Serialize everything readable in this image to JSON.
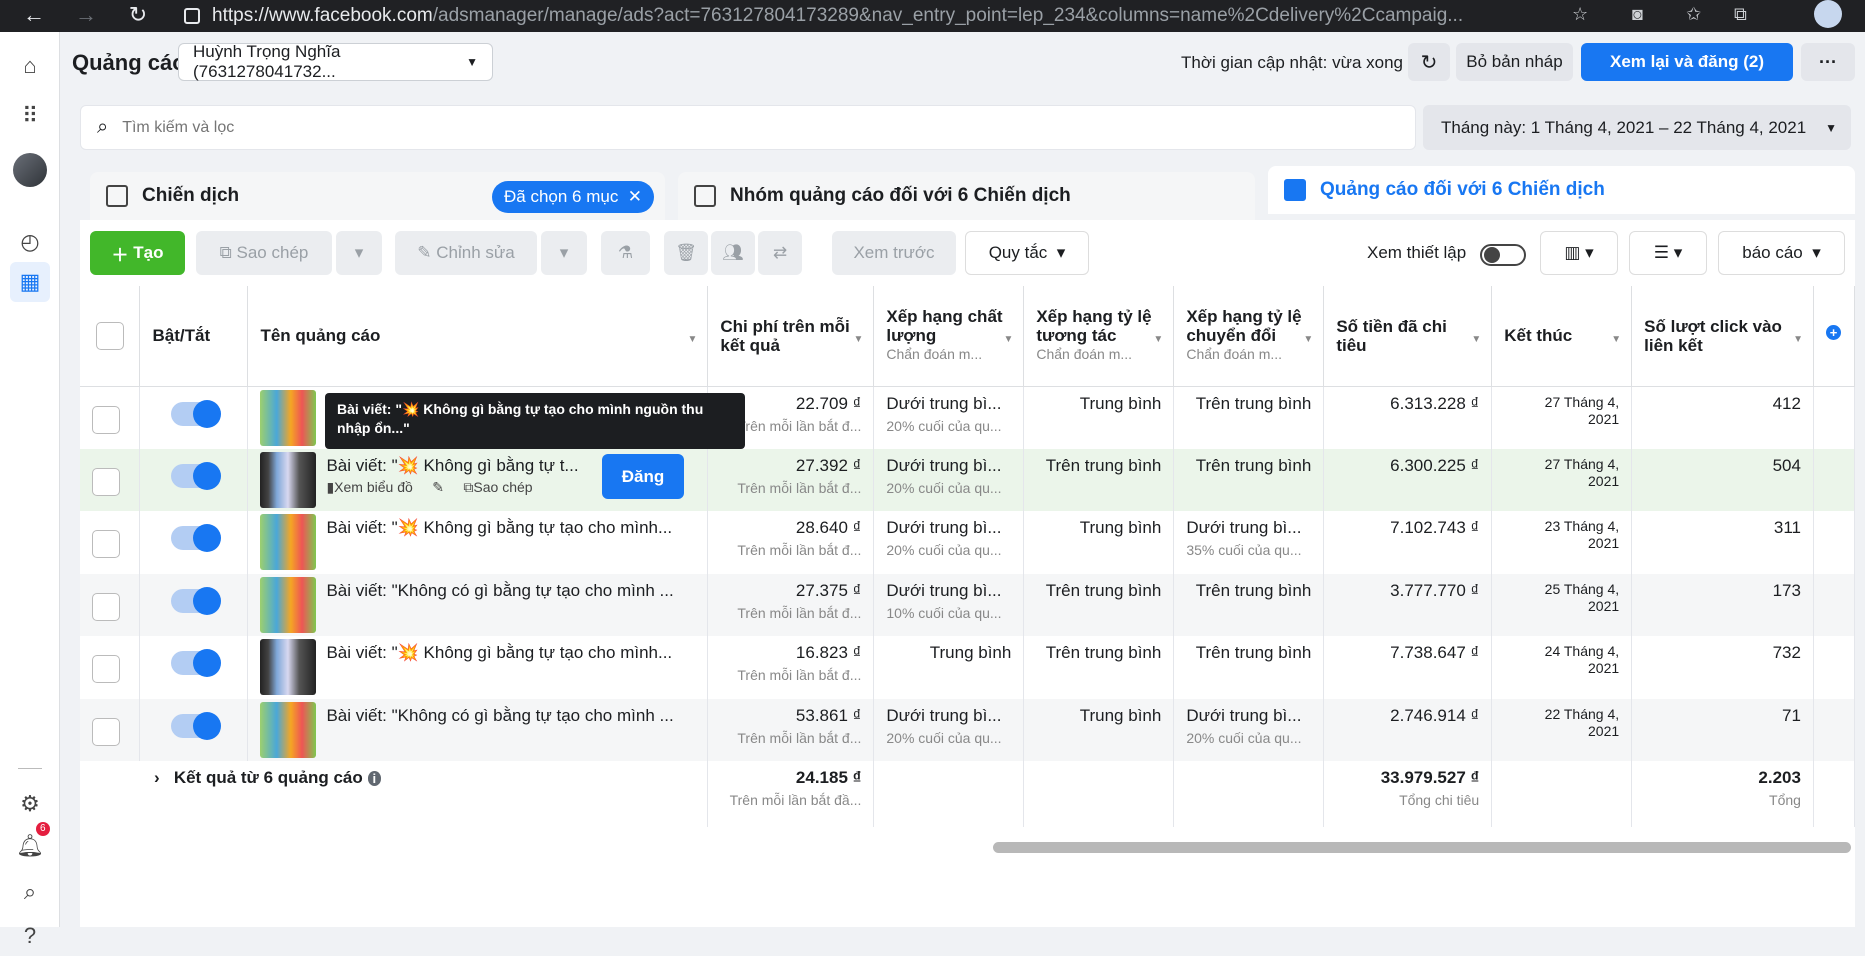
{
  "browser": {
    "url_main": "https://www.facebook.com",
    "url_rest": "/adsmanager/manage/ads?act=763127804173289&nav_entry_point=lep_234&columns=name%2Cdelivery%2Ccampaig..."
  },
  "header": {
    "title": "Quảng cáo",
    "account": "Huỳnh Trọng Nghĩa (7631278041732...",
    "update_status": "Thời gian cập nhật: vừa xong",
    "discard_drafts": "Bỏ bản nháp",
    "review_publish": "Xem lại và đăng (2)",
    "more": "···"
  },
  "search": {
    "placeholder": "Tìm kiếm và lọc"
  },
  "date_range": "Tháng này: 1 Tháng 4, 2021 – 22 Tháng 4, 2021",
  "tabs": {
    "campaigns": "Chiến dịch",
    "selected_chip": "Đã chọn 6 mục",
    "adsets": "Nhóm quảng cáo đối với 6 Chiến dịch",
    "ads": "Quảng cáo đối với 6 Chiến dịch"
  },
  "toolbar": {
    "create": "Tạo",
    "duplicate": "Sao chép",
    "edit": "Chỉnh sửa",
    "preview": "Xem trước",
    "rules": "Quy tắc",
    "view_setup": "Xem thiết lập",
    "reports": "báo cáo"
  },
  "columns": {
    "toggle": "Bật/Tắt",
    "name": "Tên quảng cáo",
    "cost_per_result": "Chi phí trên mỗi kết quả",
    "quality": "Xếp hạng chất lượng",
    "quality_sub": "Chẩn đoán m...",
    "engagement": "Xếp hạng tỷ lệ tương tác",
    "engagement_sub": "Chẩn đoán m...",
    "conversion": "Xếp hạng tỷ lệ chuyển đổi",
    "conversion_sub": "Chẩn đoán m...",
    "spent": "Số tiền đã chi tiêu",
    "ends": "Kết thúc",
    "link_clicks": "Số lượt click vào liên kết"
  },
  "rows": [
    {
      "name": "Bài viết: \"💥 Không gì bằng tự tạo cho mình...",
      "cost": "22.709 ₫",
      "cost_sub": "Trên mỗi lần bắt đ...",
      "quality": "Dưới trung bì...",
      "quality_sub": "20% cuối của qu...",
      "engagement": "Trung bình",
      "conversion": "Trên trung bình",
      "conversion_sub": "",
      "spent": "6.313.228 ₫",
      "end_1": "27 Tháng 4,",
      "end_2": "2021",
      "clicks": "412"
    },
    {
      "name": "Bài viết: \"💥 Không gì bằng tự t...",
      "cost": "27.392 ₫",
      "cost_sub": "Trên mỗi lần bắt đ...",
      "quality": "Dưới trung bì...",
      "quality_sub": "20% cuối của qu...",
      "engagement": "Trên trung bình",
      "conversion": "Trên trung bình",
      "conversion_sub": "",
      "spent": "6.300.225 ₫",
      "end_1": "27 Tháng 4,",
      "end_2": "2021",
      "clicks": "504"
    },
    {
      "name": "Bài viết: \"💥 Không gì bằng tự tạo cho mình...",
      "cost": "28.640 ₫",
      "cost_sub": "Trên mỗi lần bắt đ...",
      "quality": "Dưới trung bì...",
      "quality_sub": "20% cuối của qu...",
      "engagement": "Trung bình",
      "conversion": "Dưới trung bì...",
      "conversion_sub": "35% cuối của qu...",
      "spent": "7.102.743 ₫",
      "end_1": "23 Tháng 4,",
      "end_2": "2021",
      "clicks": "311"
    },
    {
      "name": "Bài viết: \"Không có gì bằng tự tạo cho mình ...",
      "cost": "27.375 ₫",
      "cost_sub": "Trên mỗi lần bắt đ...",
      "quality": "Dưới trung bì...",
      "quality_sub": "10% cuối của qu...",
      "engagement": "Trên trung bình",
      "conversion": "Trên trung bình",
      "conversion_sub": "",
      "spent": "3.777.770 ₫",
      "end_1": "25 Tháng 4,",
      "end_2": "2021",
      "clicks": "173"
    },
    {
      "name": "Bài viết: \"💥 Không gì bằng tự tạo cho mình...",
      "cost": "16.823 ₫",
      "cost_sub": "Trên mỗi lần bắt đ...",
      "quality": "Trung bình",
      "quality_sub": "",
      "engagement": "Trên trung bình",
      "conversion": "Trên trung bình",
      "conversion_sub": "",
      "spent": "7.738.647 ₫",
      "end_1": "24 Tháng 4,",
      "end_2": "2021",
      "clicks": "732"
    },
    {
      "name": "Bài viết: \"Không có gì bằng tự tạo cho mình ...",
      "cost": "53.861 ₫",
      "cost_sub": "Trên mỗi lần bắt đ...",
      "quality": "Dưới trung bì...",
      "quality_sub": "20% cuối của qu...",
      "engagement": "Trung bình",
      "conversion": "Dưới trung bì...",
      "conversion_sub": "20% cuối của qu...",
      "spent": "2.746.914 ₫",
      "end_1": "22 Tháng 4,",
      "end_2": "2021",
      "clicks": "71"
    }
  ],
  "row_actions": {
    "view_chart": "Xem biểu đồ",
    "duplicate": "Sao chép",
    "publish": "Đăng"
  },
  "tooltip": "Bài viết: \"💥 Không gì bằng tự tạo cho mình nguồn thu nhập ổn...\"",
  "totals": {
    "label": "Kết quả từ 6 quảng cáo",
    "cost": "24.185 ₫",
    "cost_sub": "Trên mỗi lần bắt đầ...",
    "spent": "33.979.527 ₫",
    "spent_sub": "Tổng chi tiêu",
    "clicks": "2.203",
    "clicks_sub": "Tổng"
  },
  "notifications": {
    "count": "6"
  }
}
